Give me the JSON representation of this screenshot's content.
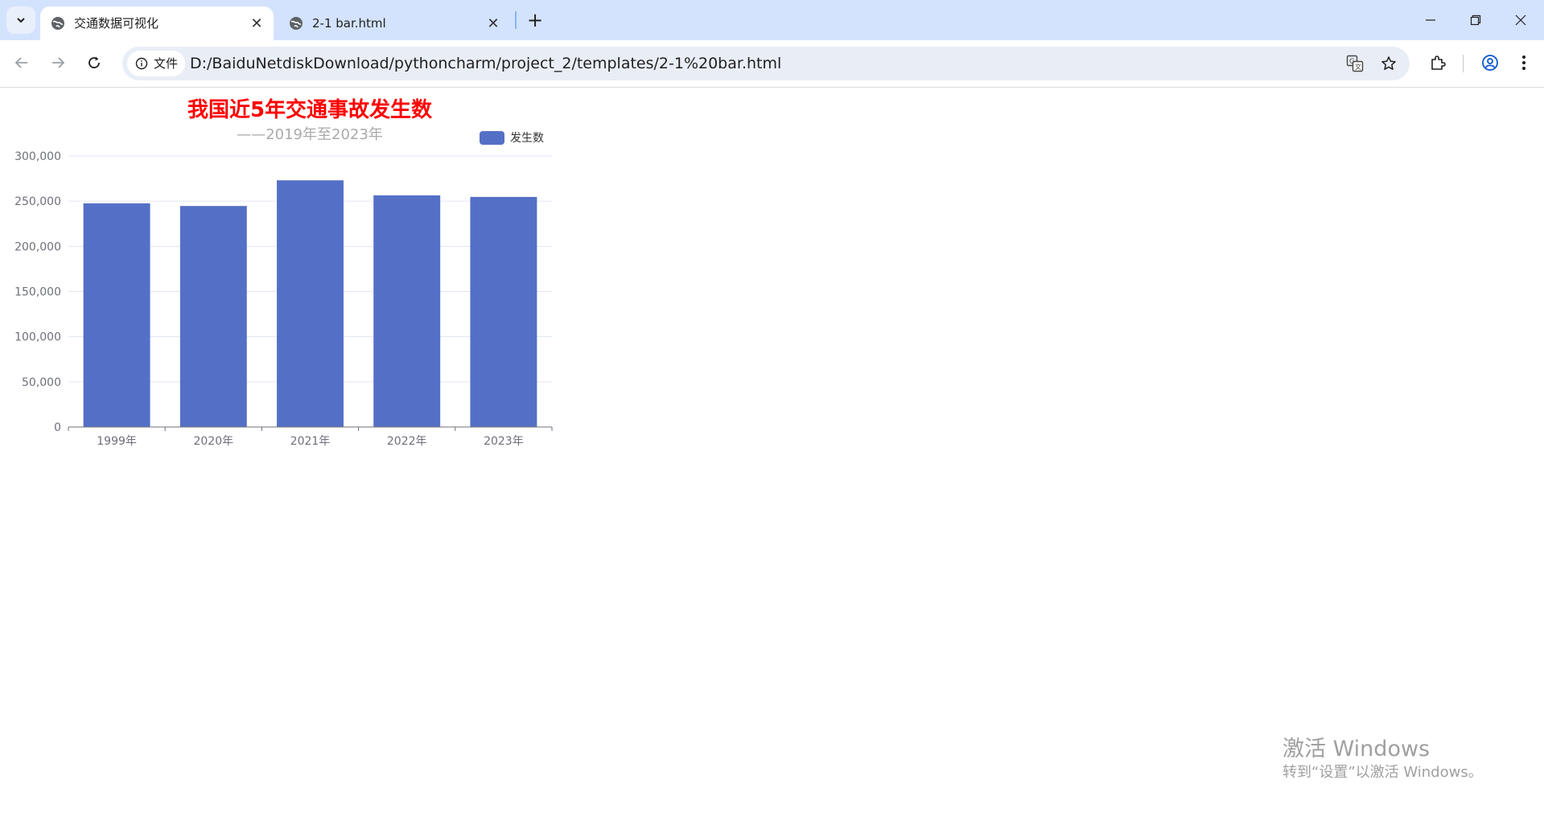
{
  "browser": {
    "tabs": [
      {
        "title": "交通数据可视化",
        "active": true
      },
      {
        "title": "2-1 bar.html",
        "active": false
      }
    ],
    "address_chip": "文件",
    "url": "D:/BaiduNetdiskDownload/pythoncharm/project_2/templates/2-1%20bar.html",
    "icons": [
      "tab-list-icon",
      "globe-icon",
      "close-icon",
      "plus-icon",
      "minimize-icon",
      "restore-icon",
      "window-close-icon",
      "back-icon",
      "forward-icon",
      "reload-icon",
      "info-icon",
      "translate-icon",
      "star-icon",
      "extensions-icon",
      "profile-icon",
      "menu-icon"
    ]
  },
  "chart_data": {
    "type": "bar",
    "title": "我国近5年交通事故发生数",
    "subtitle": "——2019年至2023年",
    "categories": [
      "1999年",
      "2020年",
      "2021年",
      "2022年",
      "2023年"
    ],
    "series": [
      {
        "name": "发生数",
        "values": [
          247650,
          244674,
          273098,
          256409,
          254703
        ]
      }
    ],
    "ylim": [
      0,
      300000
    ],
    "yticks": [
      "0",
      "50,000",
      "100,000",
      "150,000",
      "200,000",
      "250,000",
      "300,000"
    ],
    "grid": true,
    "legend": "top-right",
    "colors": {
      "bar": "#5470c6",
      "title": "#ff0000",
      "subtitle": "#aaaaaa",
      "axis_text": "#6e7079",
      "grid": "#e0e6f1"
    }
  },
  "watermark": {
    "line1": "激活 Windows",
    "line2": "转到“设置”以激活 Windows。"
  }
}
